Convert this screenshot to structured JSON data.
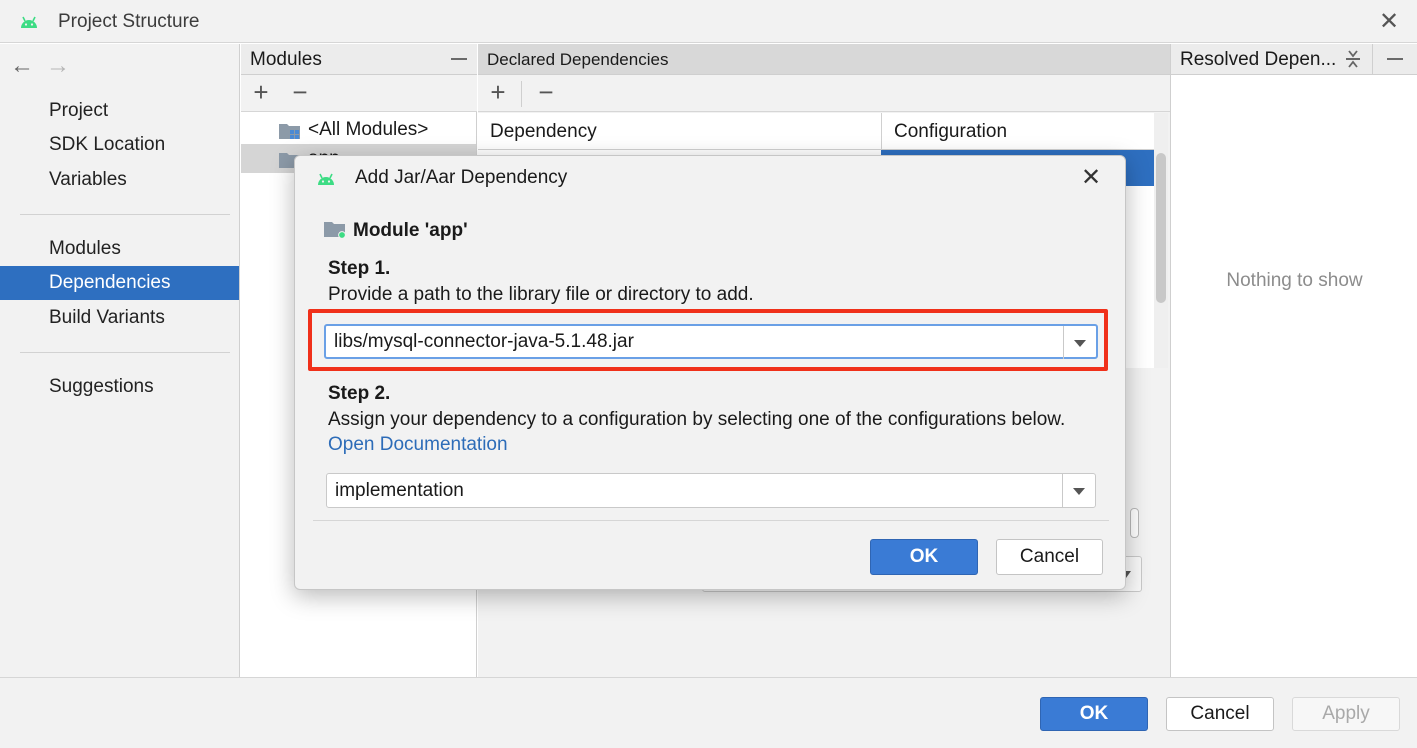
{
  "window": {
    "title": "Project Structure"
  },
  "nav": {
    "back": "←",
    "forward": "→"
  },
  "sidebar": {
    "items": [
      {
        "label": "Project"
      },
      {
        "label": "SDK Location"
      },
      {
        "label": "Variables"
      },
      {
        "label": "Modules"
      },
      {
        "label": "Dependencies",
        "selected": true
      },
      {
        "label": "Build Variants"
      },
      {
        "label": "Suggestions"
      }
    ]
  },
  "modules_panel": {
    "header": "Modules",
    "add": "+",
    "remove": "−",
    "rows": [
      {
        "label": "<All Modules>"
      },
      {
        "label": "app",
        "selected": true
      }
    ]
  },
  "declared_panel": {
    "header": "Declared Dependencies",
    "add": "+",
    "remove": "−",
    "columns": [
      "Dependency",
      "Configuration"
    ]
  },
  "resolved_panel": {
    "header": "Resolved Depen...",
    "empty_text": "Nothing to show"
  },
  "footer": {
    "ok_label": "OK",
    "cancel_label": "Cancel",
    "apply_label": "Apply"
  },
  "dialog": {
    "title": "Add Jar/Aar Dependency",
    "module_label": "Module 'app'",
    "step1_title": "Step 1.",
    "step1_desc": "Provide a path to the library file or directory to add.",
    "path_value": "libs/mysql-connector-java-5.1.48.jar",
    "step2_title": "Step 2.",
    "step2_desc": "Assign your dependency to a configuration by selecting one of the configurations below.",
    "doc_link": "Open Documentation",
    "configuration_value": "implementation",
    "ok_label": "OK",
    "cancel_label": "Cancel"
  },
  "colors": {
    "accent": "#2e6fc0",
    "primary_button": "#3a7bd5",
    "highlight_border": "#f0301a",
    "android_green": "#3ddc84",
    "link": "#2d6cb8"
  }
}
